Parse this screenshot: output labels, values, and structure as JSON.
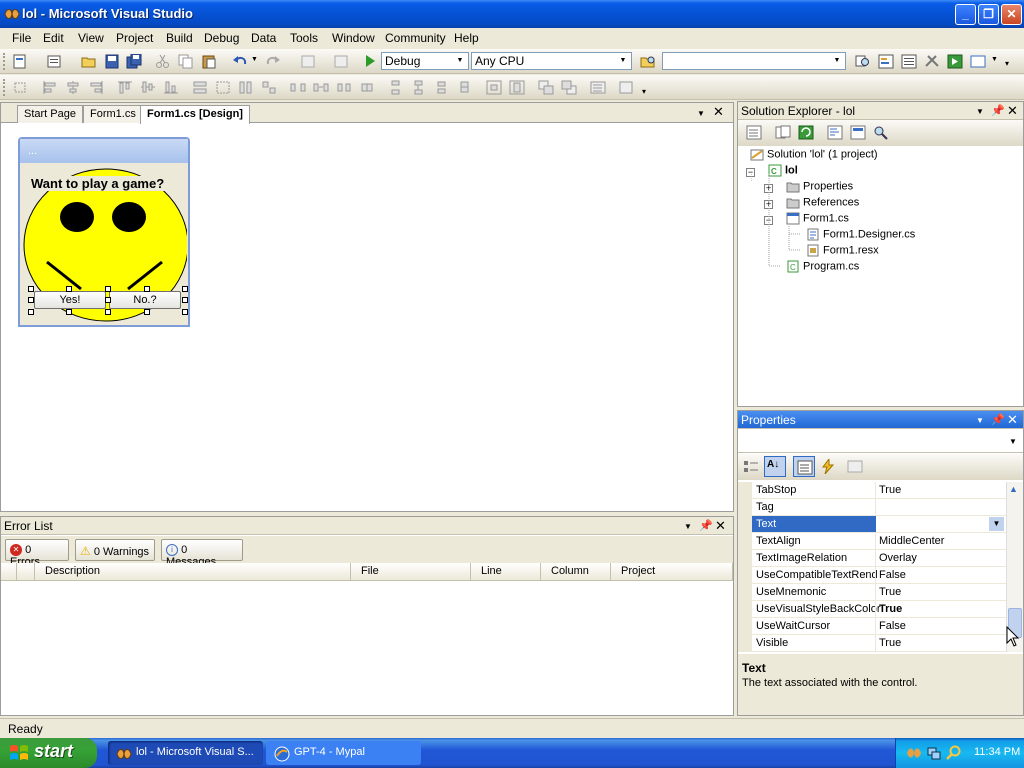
{
  "window": {
    "title": "lol - Microsoft Visual Studio"
  },
  "menu": [
    "File",
    "Edit",
    "View",
    "Project",
    "Build",
    "Debug",
    "Data",
    "Tools",
    "Window",
    "Community",
    "Help"
  ],
  "toolbar": {
    "config": "Debug",
    "platform": "Any CPU",
    "find_value": ""
  },
  "doc_tabs": [
    {
      "label": "Start Page",
      "active": false
    },
    {
      "label": "Form1.cs",
      "active": false
    },
    {
      "label": "Form1.cs [Design]",
      "active": true
    }
  ],
  "form_designer": {
    "form_title": "...",
    "label_text": "Want to play a game?",
    "button_yes": "Yes!",
    "button_no": "No.?",
    "face_color": "#ffff00"
  },
  "solution_explorer": {
    "title": "Solution Explorer - lol",
    "solution": "Solution 'lol' (1 project)",
    "project": "lol",
    "items": [
      "Properties",
      "References",
      "Form1.cs"
    ],
    "form_children": [
      "Form1.Designer.cs",
      "Form1.resx"
    ],
    "program": "Program.cs"
  },
  "properties": {
    "title": "Properties",
    "rows": [
      {
        "name": "TabStop",
        "value": "True"
      },
      {
        "name": "Tag",
        "value": ""
      },
      {
        "name": "Text",
        "value": ""
      },
      {
        "name": "TextAlign",
        "value": "MiddleCenter"
      },
      {
        "name": "TextImageRelation",
        "value": "Overlay"
      },
      {
        "name": "UseCompatibleTextRend",
        "value": "False"
      },
      {
        "name": "UseMnemonic",
        "value": "True"
      },
      {
        "name": "UseVisualStyleBackColor",
        "value": "True"
      },
      {
        "name": "UseWaitCursor",
        "value": "False"
      },
      {
        "name": "Visible",
        "value": "True"
      }
    ],
    "desc_title": "Text",
    "desc_text": "The text associated with the control."
  },
  "error_list": {
    "title": "Error List",
    "errors": "0 Errors",
    "warnings": "0 Warnings",
    "messages": "0 Messages",
    "columns": [
      "Description",
      "File",
      "Line",
      "Column",
      "Project"
    ]
  },
  "status": {
    "text": "Ready"
  },
  "taskbar": {
    "start": "start",
    "tasks": [
      "lol - Microsoft Visual S...",
      "GPT-4 - Mypal"
    ],
    "clock": "11:34 PM"
  }
}
